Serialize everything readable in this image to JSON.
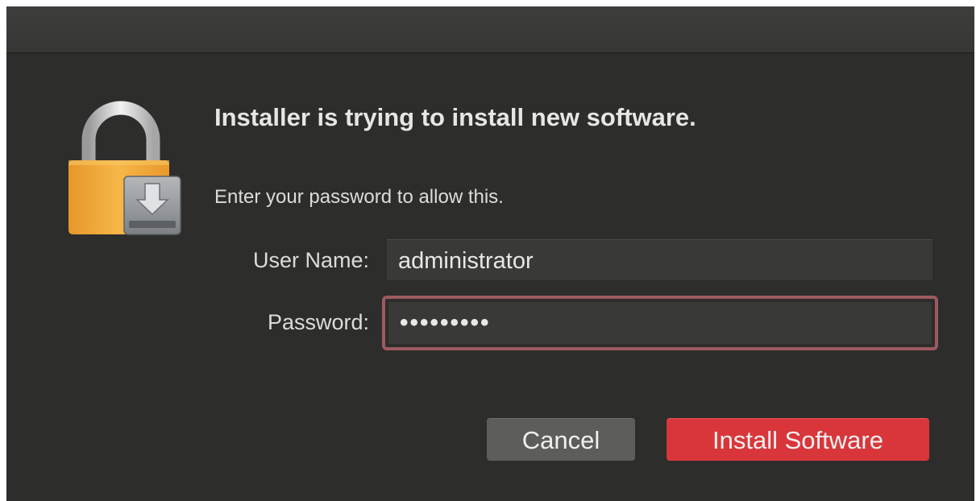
{
  "dialog": {
    "heading": "Installer is trying to install new software.",
    "message": "Enter your password to allow this.",
    "icon": "lock-with-installer-icon"
  },
  "form": {
    "username_label": "User Name:",
    "username_value": "administrator",
    "password_label": "Password:",
    "password_value": "•••••••••"
  },
  "buttons": {
    "cancel_label": "Cancel",
    "install_label": "Install Software"
  },
  "colors": {
    "window_bg": "#2d2d2b",
    "accent": "#d9363b",
    "focus_ring": "#9c5a60",
    "lock_gold": "#f0a938"
  }
}
